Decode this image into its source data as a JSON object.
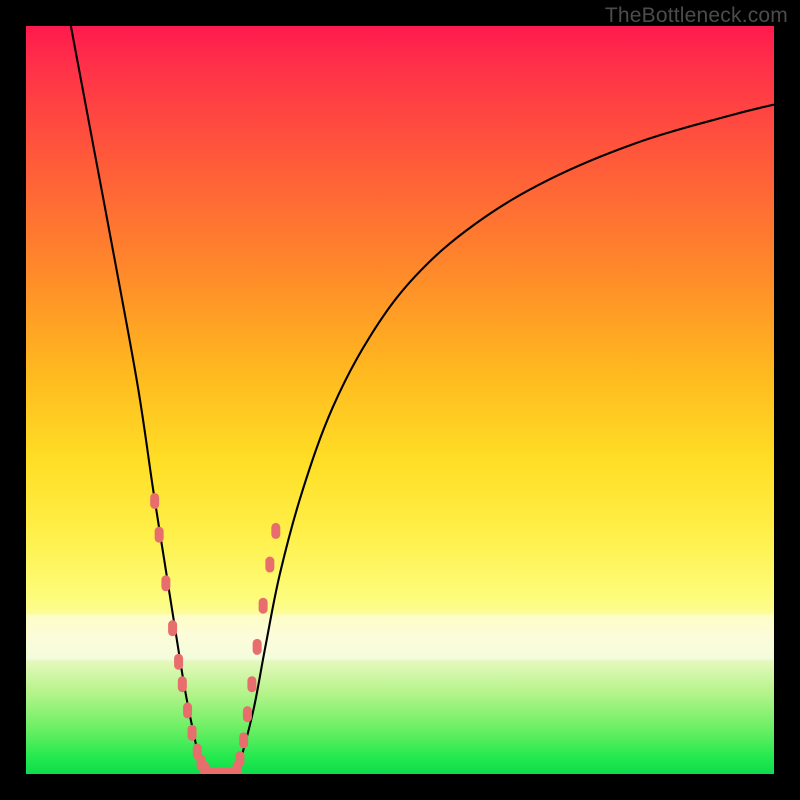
{
  "watermark": "TheBottleneck.com",
  "chart_data": {
    "type": "line",
    "title": "",
    "xlabel": "",
    "ylabel": "",
    "xlim": [
      0,
      100
    ],
    "ylim": [
      0,
      100
    ],
    "left_branch": {
      "x": [
        6,
        9,
        12,
        15,
        17,
        18.5,
        20,
        21.3,
        22.5,
        23.2,
        24
      ],
      "y": [
        100,
        84,
        68,
        51.5,
        38,
        28.5,
        19,
        11,
        5,
        2,
        0
      ]
    },
    "right_branch": {
      "x": [
        28,
        29,
        30.5,
        32,
        34,
        37,
        41,
        46,
        52,
        60,
        70,
        82,
        94,
        100
      ],
      "y": [
        0,
        3,
        9,
        17,
        27,
        38,
        49,
        58.5,
        66.5,
        73.5,
        79.5,
        84.5,
        88,
        89.5
      ]
    },
    "flat_bottom": {
      "x": [
        24,
        28
      ],
      "y": [
        0,
        0
      ]
    },
    "markers_left": {
      "x": [
        17.2,
        17.8,
        18.7,
        19.6,
        20.4,
        20.9,
        21.6,
        22.2,
        22.9,
        23.4,
        23.9
      ],
      "y": [
        36.5,
        32,
        25.5,
        19.5,
        15,
        12,
        8.5,
        5.5,
        3,
        1.5,
        0.6
      ]
    },
    "markers_right": {
      "x": [
        28.2,
        28.6,
        29.1,
        29.6,
        30.2,
        30.9,
        31.7,
        32.6,
        33.4
      ],
      "y": [
        0.6,
        2,
        4.5,
        8,
        12,
        17,
        22.5,
        28,
        32.5
      ]
    },
    "markers_bottom": {
      "x": [
        24.3,
        25.1,
        25.9,
        26.8,
        27.6
      ],
      "y": [
        0,
        0,
        0,
        0,
        0
      ]
    },
    "gradient_stops": [
      {
        "pos": 0,
        "color": "#ff1a4e"
      },
      {
        "pos": 18,
        "color": "#ff5a3a"
      },
      {
        "pos": 46,
        "color": "#ffb81f"
      },
      {
        "pos": 68,
        "color": "#fff04a"
      },
      {
        "pos": 84,
        "color": "#e9f9c1"
      },
      {
        "pos": 100,
        "color": "#0fdb4c"
      }
    ],
    "marker_color": "#e86d6d",
    "curve_color": "#000000"
  }
}
